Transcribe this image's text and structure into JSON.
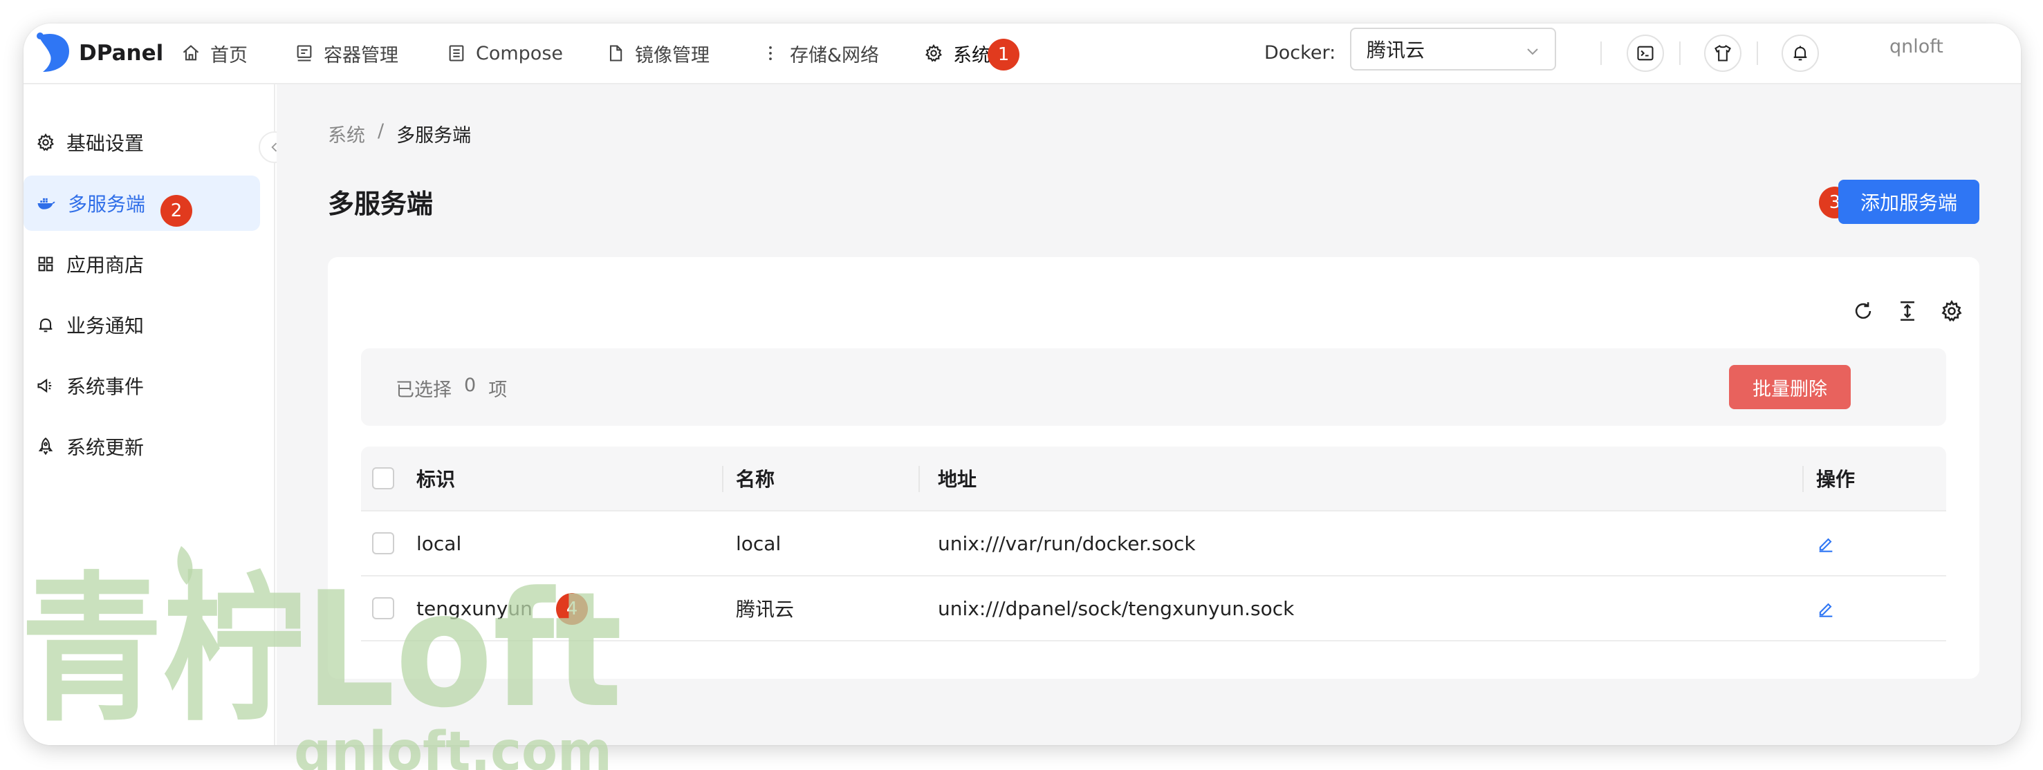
{
  "header": {
    "brand": "DPanel",
    "nav": [
      {
        "label": "首页",
        "icon": "home-icon"
      },
      {
        "label": "容器管理",
        "icon": "container-icon"
      },
      {
        "label": "Compose",
        "icon": "compose-icon"
      },
      {
        "label": "镜像管理",
        "icon": "file-icon"
      },
      {
        "label": "存储&网络",
        "icon": "more-vertical-icon"
      },
      {
        "label": "系统",
        "icon": "gear-icon"
      }
    ],
    "docker_label": "Docker:",
    "docker_selected": "腾讯云",
    "user": "qnloft"
  },
  "sidebar": {
    "items": [
      {
        "label": "基础设置",
        "icon": "gear-icon"
      },
      {
        "label": "多服务端",
        "icon": "docker-icon",
        "active": true
      },
      {
        "label": "应用商店",
        "icon": "grid-icon"
      },
      {
        "label": "业务通知",
        "icon": "bell-icon"
      },
      {
        "label": "系统事件",
        "icon": "megaphone-icon"
      },
      {
        "label": "系统更新",
        "icon": "rocket-icon"
      }
    ]
  },
  "main": {
    "breadcrumb": [
      "系统",
      "/",
      "多服务端"
    ],
    "title": "多服务端",
    "add_button": "添加服务端",
    "selection": {
      "prefix": "已选择",
      "count": "0",
      "suffix": "项"
    },
    "batch_delete": "批量删除",
    "columns": [
      "标识",
      "名称",
      "地址",
      "操作"
    ],
    "rows": [
      {
        "id": "local",
        "name": "local",
        "address": "unix:///var/run/docker.sock"
      },
      {
        "id": "tengxunyun",
        "name": "腾讯云",
        "address": "unix:///dpanel/sock/tengxunyun.sock"
      }
    ]
  },
  "annotations": [
    "1",
    "2",
    "3",
    "4"
  ],
  "watermark": {
    "title": "青柠Loft",
    "url": "qnloft.com"
  },
  "colors": {
    "accent": "#2f76f4",
    "danger": "#e8625d",
    "badge": "#e13a1e",
    "active_bg": "#e9f2ff"
  }
}
